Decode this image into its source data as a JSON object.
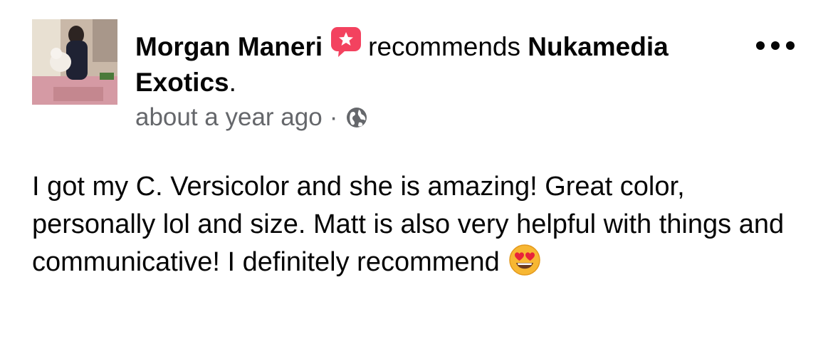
{
  "post": {
    "author": "Morgan Maneri",
    "action": "recommends",
    "page_name": "Nukamedia Exotics",
    "page_suffix": ".",
    "timestamp": "about a year ago",
    "separator": "·",
    "privacy_icon": "globe-icon",
    "badge_icon": "recommendation-star-icon",
    "badge_color": "#f3425f",
    "more_icon": "more-horizontal-icon",
    "text": "I got my C. Versicolor and she is amazing! Great color, personally lol and size. Matt is also very helpful with things and communicative! I definitely recommend",
    "emoji_icon": "heart-eyes-emoji-icon"
  }
}
